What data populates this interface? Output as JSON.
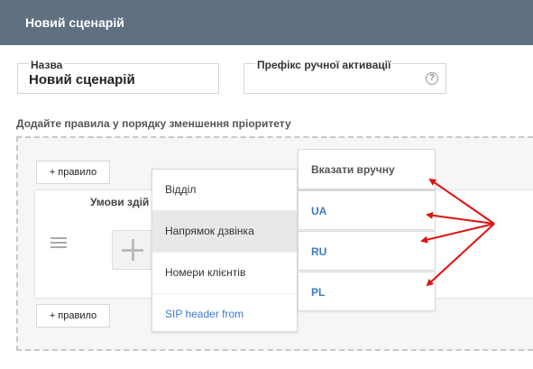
{
  "header": {
    "title": "Новий сценарій"
  },
  "form": {
    "name_label": "Назва",
    "name_value": "Новий сценарій",
    "prefix_label": "Префікс ручної активації",
    "help_glyph": "?"
  },
  "rules": {
    "instructions": "Додайте правила у порядку зменшення пріоритету",
    "add_rule_label": "+ правило",
    "conditions_label": "Умови здій"
  },
  "condition_menu": {
    "items": [
      "Відділ",
      "Напрямок дзвінка",
      "Номери клієнтів",
      "SIP header from"
    ],
    "active_index": 1
  },
  "value_menu": {
    "header": "Вказати вручну",
    "options": [
      "UA",
      "RU",
      "PL"
    ]
  },
  "colors": {
    "titlebar": "#5f7080",
    "link": "#3a7bc8",
    "annotation_arrow": "#e01010"
  },
  "icons": [
    "help-icon",
    "drag-handle-icon",
    "plus-icon",
    "annotation-arrows"
  ]
}
